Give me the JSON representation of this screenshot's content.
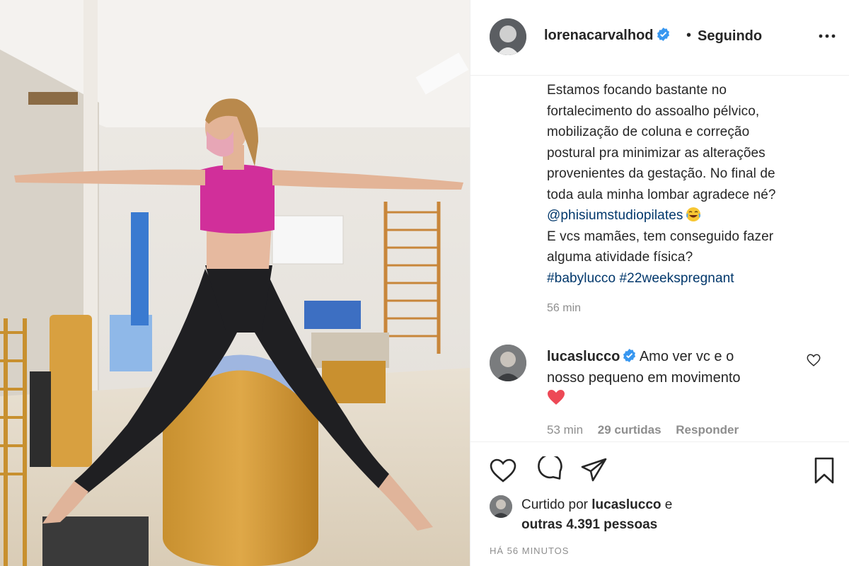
{
  "post": {
    "author": "lorenacarvalhod",
    "separator": "•",
    "follow_state": "Seguindo",
    "caption_lines": [
      "Estamos focando bastante no",
      "fortalecimento do assoalho pélvico,",
      "mobilização de coluna e correção",
      "postural pra minimizar as alterações",
      "provenientes da gestação. No final de",
      "toda aula minha lombar agradece né?"
    ],
    "mention": "@phisiumstudiopilates",
    "caption_lines_2": [
      "E vcs mamães, tem conseguido fazer",
      "alguma atividade física?"
    ],
    "hashtags": [
      "#babylucco",
      "#22weekspregnant"
    ],
    "caption_time": "56 min"
  },
  "comment": {
    "user": "lucaslucco",
    "text_line_1": "Amo ver vc e o",
    "text_line_2": "nosso pequeno em movimento",
    "time": "53 min",
    "likes": "29 curtidas",
    "reply_label": "Responder"
  },
  "likes": {
    "prefix": "Curtido por",
    "user": "lucaslucco",
    "conjunction": "e",
    "others": "outras 4.391 pessoas"
  },
  "timestamp": "HÁ 56 MINUTOS",
  "icons": {
    "verified": "verified-badge-icon",
    "more": "more-options-icon",
    "like": "heart-icon",
    "comment": "comment-icon",
    "share": "share-icon",
    "save": "bookmark-icon",
    "emoji": "laughing-crying-emoji",
    "comment_emoji": "red-heart-emoji"
  },
  "colors": {
    "link": "#00376b",
    "verified": "#3897f0",
    "secondary_text": "#8e8e8e",
    "heart_red": "#ed4956"
  }
}
